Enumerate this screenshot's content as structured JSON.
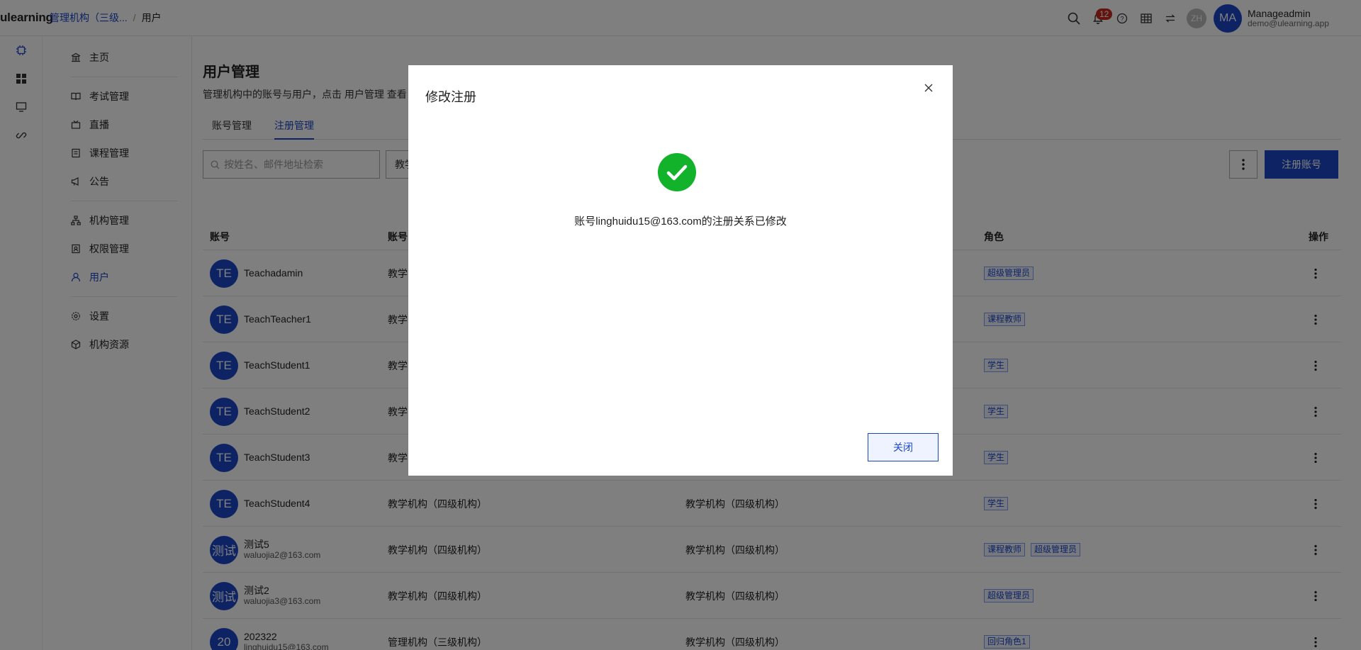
{
  "topbar": {
    "logo": "ulearning",
    "breadcrumb_org": "管理机构（三级...",
    "breadcrumb_sep": "/",
    "breadcrumb_current": "用户",
    "notification_count": "12",
    "language": "ZH",
    "user": {
      "initials": "MA",
      "name": "Manageadmin",
      "email": "demo@ulearning.app"
    }
  },
  "sidenav": {
    "items": [
      {
        "label": "主页",
        "icon": "bank-icon"
      },
      {
        "label": "考试管理",
        "icon": "book-icon"
      },
      {
        "label": "直播",
        "icon": "video-icon"
      },
      {
        "label": "课程管理",
        "icon": "course-icon"
      },
      {
        "label": "公告",
        "icon": "megaphone-icon"
      },
      {
        "label": "机构管理",
        "icon": "org-tree-icon"
      },
      {
        "label": "权限管理",
        "icon": "permission-icon"
      },
      {
        "label": "用户",
        "icon": "user-icon"
      },
      {
        "label": "设置",
        "icon": "gear-icon"
      },
      {
        "label": "机构资源",
        "icon": "cube-icon"
      }
    ]
  },
  "main": {
    "title": "用户管理",
    "description": "管理机构中的账号与用户，点击 用户管理 查看",
    "tabs": [
      {
        "label": "账号管理"
      },
      {
        "label": "注册管理"
      }
    ],
    "search_placeholder": "按姓名、邮件地址检索",
    "filter_label": "教学",
    "register_button": "注册账号",
    "columns": {
      "account": "账号",
      "account_org": "账号",
      "role": "角色",
      "action": "操作"
    },
    "rows": [
      {
        "initials": "TE",
        "name": "Teachadamin",
        "sub": "",
        "org1": "教学",
        "org2": "",
        "roles": [
          "超级管理员"
        ]
      },
      {
        "initials": "TE",
        "name": "TeachTeacher1",
        "sub": "",
        "org1": "教学",
        "org2": "",
        "roles": [
          "课程教师"
        ]
      },
      {
        "initials": "TE",
        "name": "TeachStudent1",
        "sub": "",
        "org1": "教学",
        "org2": "",
        "roles": [
          "学生"
        ]
      },
      {
        "initials": "TE",
        "name": "TeachStudent2",
        "sub": "",
        "org1": "教学",
        "org2": "",
        "roles": [
          "学生"
        ]
      },
      {
        "initials": "TE",
        "name": "TeachStudent3",
        "sub": "",
        "org1": "教学",
        "org2": "",
        "roles": [
          "学生"
        ]
      },
      {
        "initials": "TE",
        "name": "TeachStudent4",
        "sub": "",
        "org1": "教学机构（四级机构）",
        "org2": "教学机构（四级机构）",
        "roles": [
          "学生"
        ]
      },
      {
        "initials": "测试",
        "name": "测试5",
        "sub": "waluojia2@163.com",
        "org1": "教学机构（四级机构）",
        "org2": "教学机构（四级机构）",
        "roles": [
          "课程教师",
          "超级管理员"
        ]
      },
      {
        "initials": "测试",
        "name": "测试2",
        "sub": "waluojia3@163.com",
        "org1": "教学机构（四级机构）",
        "org2": "教学机构（四级机构）",
        "roles": [
          "超级管理员"
        ]
      },
      {
        "initials": "20",
        "name": "202322",
        "sub": "linghuidu15@163.com",
        "org1": "管理机构（三级机构）",
        "org2": "教学机构（四级机构）",
        "roles": [
          "回归角色1"
        ]
      }
    ]
  },
  "modal": {
    "title": "修改注册",
    "message": "账号linghuidu15@163.com的注册关系已修改",
    "close_button": "关闭"
  },
  "colors": {
    "primary": "#1a47c9",
    "success": "#12b32a",
    "badge": "#c8271f"
  }
}
